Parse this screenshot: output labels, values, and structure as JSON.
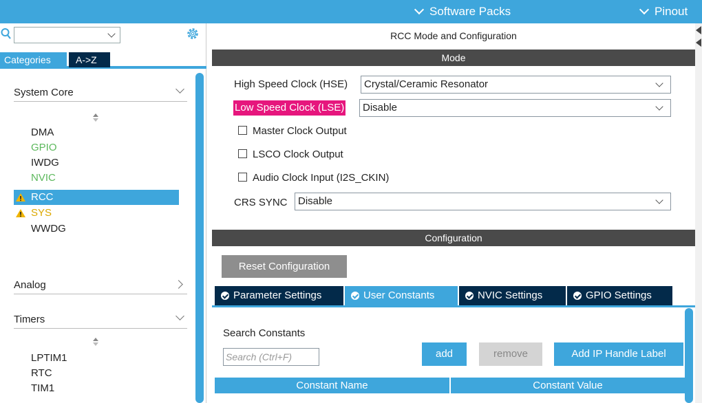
{
  "topbar": {
    "software_packs": "Software Packs",
    "pinout": "Pinout"
  },
  "left": {
    "search": {
      "value": ""
    },
    "tabs": {
      "categories": "Categories",
      "atoz": "A->Z"
    },
    "sections": {
      "system_core": "System Core",
      "analog": "Analog",
      "timers": "Timers"
    },
    "system_core_items": [
      {
        "label": "DMA",
        "state": "normal"
      },
      {
        "label": "GPIO",
        "state": "configured"
      },
      {
        "label": "IWDG",
        "state": "normal"
      },
      {
        "label": "NVIC",
        "state": "configured"
      },
      {
        "label": "RCC",
        "state": "selected-warning"
      },
      {
        "label": "SYS",
        "state": "warning"
      },
      {
        "label": "WWDG",
        "state": "normal"
      }
    ],
    "timers_items": [
      {
        "label": "LPTIM1"
      },
      {
        "label": "RTC"
      },
      {
        "label": "TIM1"
      }
    ]
  },
  "main": {
    "title": "RCC Mode and Configuration",
    "mode_band": "Mode",
    "hse": {
      "label": "High Speed Clock (HSE)",
      "value": "Crystal/Ceramic Resonator"
    },
    "lse": {
      "label": "Low Speed Clock (LSE)",
      "value": "Disable"
    },
    "checkboxes": {
      "mco": "Master Clock Output",
      "lsco": "LSCO Clock Output",
      "i2s": "Audio Clock Input (I2S_CKIN)"
    },
    "crs": {
      "label": "CRS SYNC",
      "value": "Disable"
    },
    "config_band": "Configuration",
    "reset_button": "Reset Configuration",
    "tabs": {
      "param": "Parameter Settings",
      "user": "User Constants",
      "nvic": "NVIC Settings",
      "gpio": "GPIO Settings"
    },
    "search_constants_label": "Search Constants",
    "search_placeholder": "Search (Ctrl+F)",
    "buttons": {
      "add": "add",
      "remove": "remove",
      "add_ip": "Add IP Handle Label"
    },
    "table_headers": {
      "name": "Constant Name",
      "value": "Constant Value"
    }
  },
  "colors": {
    "accent": "#3ea6dc",
    "dark_navy": "#032a4a",
    "band_gray": "#4a4a4a",
    "highlight_pink": "#e6167d",
    "configured_green": "#5cb85c",
    "warning_yellow": "#dca800"
  },
  "icons": {
    "search": "search-icon",
    "gear": "gear-icon",
    "warning": "warning-icon",
    "check": "check-circle-icon"
  }
}
